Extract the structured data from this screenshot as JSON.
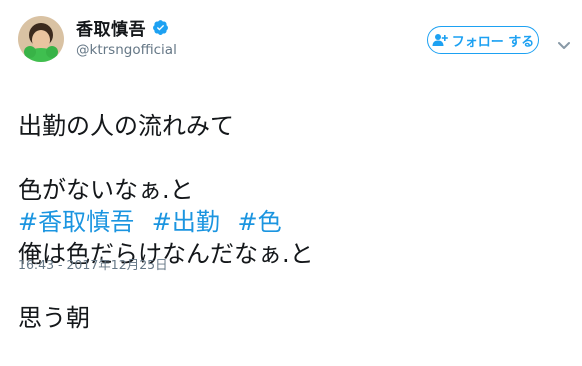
{
  "user": {
    "display_name": "香取慎吾",
    "handle": "@ktrsngofficial",
    "verified": true,
    "avatar_icon": "avatar-profile-photo"
  },
  "follow_button": {
    "label": "フォロー する",
    "icon": "add-user-icon"
  },
  "caret_icon": "chevron-down-icon",
  "tweet": {
    "lines": [
      "出勤の人の流れみて",
      "色がないなぁ.と",
      "俺は色だらけなんだなぁ.と",
      "思う朝"
    ],
    "hashtags": [
      "#香取慎吾",
      "#出勤",
      "#色"
    ]
  },
  "timestamp": "16:43 - 2017年12月25日",
  "colors": {
    "accent": "#1da1f2",
    "hashtag": "#1b95e0",
    "secondary_text": "#657786",
    "primary_text": "#14171a"
  }
}
